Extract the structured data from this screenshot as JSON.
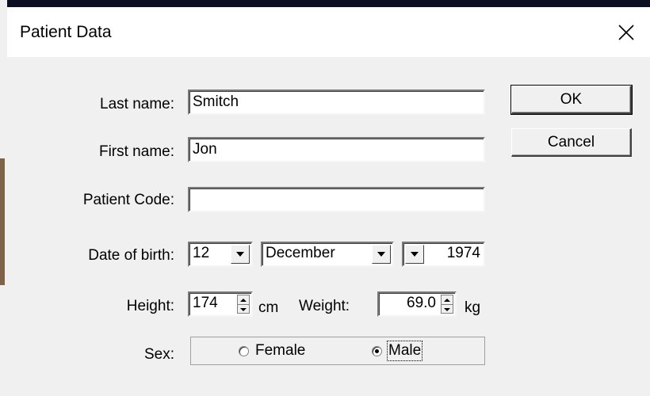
{
  "window": {
    "title": "Patient Data",
    "close_symbol": "✕"
  },
  "labels": {
    "last_name": "Last name:",
    "first_name": "First name:",
    "patient_code": "Patient Code:",
    "date_of_birth": "Date of birth:",
    "height": "Height:",
    "weight": "Weight:",
    "sex": "Sex:"
  },
  "fields": {
    "last_name": "Smitch",
    "first_name": "Jon",
    "patient_code": "",
    "dob_day": "12",
    "dob_month": "December",
    "dob_year": "1974",
    "height": "174",
    "weight": "69.0"
  },
  "units": {
    "height": "cm",
    "weight": "kg"
  },
  "sex": {
    "female_label": "Female",
    "male_label": "Male",
    "selected": "Male"
  },
  "buttons": {
    "ok": "OK",
    "cancel": "Cancel"
  }
}
